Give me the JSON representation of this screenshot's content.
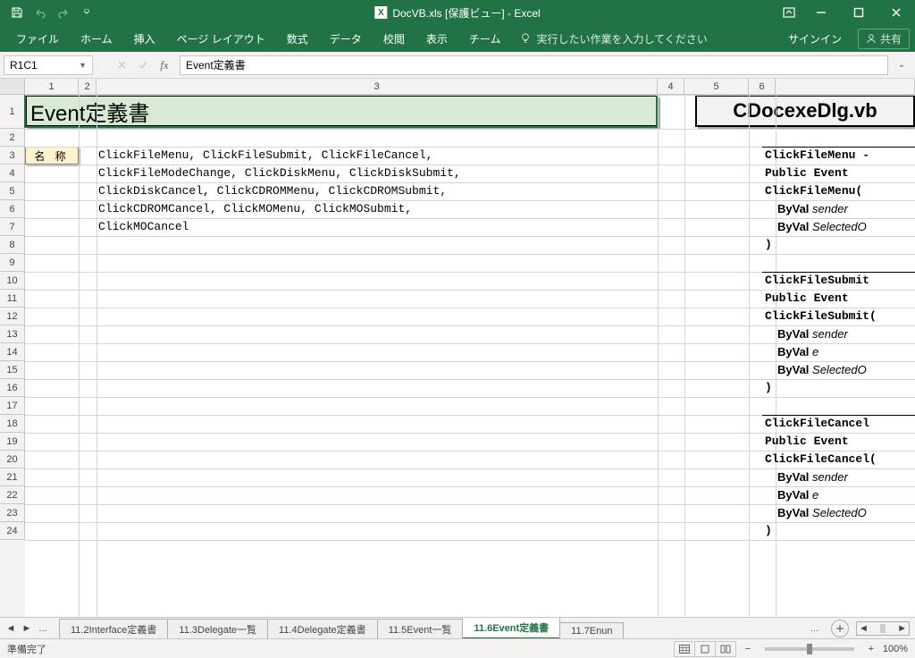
{
  "window": {
    "title": "DocVB.xls  [保護ビュー] - Excel"
  },
  "ribbon": {
    "tabs": [
      "ファイル",
      "ホーム",
      "挿入",
      "ページ レイアウト",
      "数式",
      "データ",
      "校閲",
      "表示",
      "チーム"
    ],
    "tell_me": "実行したい作業を入力してください",
    "sign_in": "サインイン",
    "share": "共有"
  },
  "formula_bar": {
    "name_box": "R1C1",
    "formula": "Event定義書"
  },
  "columns": [
    "1",
    "2",
    "3",
    "4",
    "5",
    "6"
  ],
  "rows": [
    "1",
    "2",
    "3",
    "4",
    "5",
    "6",
    "7",
    "8",
    "9",
    "10",
    "11",
    "12",
    "13",
    "14",
    "15",
    "16",
    "17",
    "18",
    "19",
    "20",
    "21",
    "22",
    "23",
    "24"
  ],
  "cells": {
    "title": "Event定義書",
    "file_title": "CDocexeDlg.vb",
    "label": "名 称",
    "body": [
      "ClickFileMenu, ClickFileSubmit, ClickFileCancel,",
      "ClickFileModeChange, ClickDiskMenu, ClickDiskSubmit,",
      "ClickDiskCancel, ClickCDROMMenu, ClickCDROMSubmit,",
      "ClickCDROMCancel, ClickMOMenu, ClickMOSubmit,",
      "ClickMOCancel"
    ],
    "right_blocks": [
      {
        "lines": [
          {
            "t": "ClickFileMenu -",
            "indent": false
          },
          {
            "t": "Public Event",
            "indent": false
          },
          {
            "t": "ClickFileMenu(",
            "indent": false
          },
          {
            "t": "ByVal ",
            "tail": "sender",
            "indent": true
          },
          {
            "t": "ByVal ",
            "tail": "SelectedO",
            "indent": true
          },
          {
            "t": ")",
            "indent": false
          }
        ]
      },
      {
        "lines": [
          {
            "t": "ClickFileSubmit",
            "indent": false
          },
          {
            "t": "Public Event",
            "indent": false
          },
          {
            "t": "ClickFileSubmit(",
            "indent": false
          },
          {
            "t": "ByVal ",
            "tail": "sender",
            "indent": true
          },
          {
            "t": "ByVal ",
            "tail": "e",
            "indent": true
          },
          {
            "t": "ByVal ",
            "tail": "SelectedO",
            "indent": true
          },
          {
            "t": ")",
            "indent": false
          }
        ]
      },
      {
        "lines": [
          {
            "t": "ClickFileCancel",
            "indent": false
          },
          {
            "t": "Public Event",
            "indent": false
          },
          {
            "t": "ClickFileCancel(",
            "indent": false
          },
          {
            "t": "ByVal ",
            "tail": "sender",
            "indent": true
          },
          {
            "t": "ByVal ",
            "tail": "e",
            "indent": true
          },
          {
            "t": "ByVal ",
            "tail": "SelectedO",
            "indent": true
          },
          {
            "t": ")",
            "indent": false
          }
        ]
      }
    ]
  },
  "sheet_tabs": {
    "ellipsis": "...",
    "tabs": [
      {
        "label": "11.2Interface定義書",
        "active": false
      },
      {
        "label": "11.3Delegate一覧",
        "active": false
      },
      {
        "label": "11.4Delegate定義書",
        "active": false
      },
      {
        "label": "11.5Event一覧",
        "active": false
      },
      {
        "label": "11.6Event定義書",
        "active": true
      },
      {
        "label": "11.7Enun",
        "active": false
      }
    ],
    "more": "..."
  },
  "status": {
    "ready": "準備完了",
    "zoom": "100%"
  }
}
